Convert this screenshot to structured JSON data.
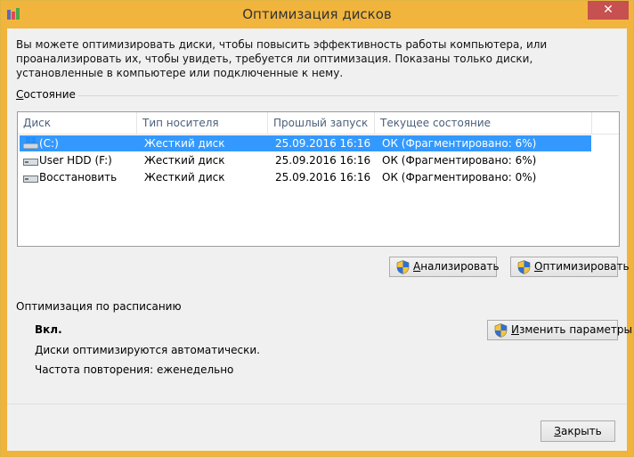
{
  "window": {
    "title": "Оптимизация дисков",
    "close_glyph": "✕"
  },
  "description": "Вы можете оптимизировать диски, чтобы повысить эффективность работы  компьютера, или проанализировать их, чтобы увидеть, требуется ли оптимизация. Показаны только диски, установленные в компьютере или подключенные к нему.",
  "status_group": {
    "label_first": "С",
    "label_rest": "остояние"
  },
  "table": {
    "columns": [
      "Диск",
      "Тип носителя",
      "Прошлый запуск",
      "Текущее состояние"
    ],
    "rows": [
      {
        "disk": "(C:)",
        "type": "Жесткий диск",
        "last_run": "25.09.2016 16:16",
        "status": "ОК (Фрагментировано: 6%)",
        "icon": "windows-drive-icon",
        "selected": true
      },
      {
        "disk": "User HDD (F:)",
        "type": "Жесткий диск",
        "last_run": "25.09.2016 16:16",
        "status": "ОК (Фрагментировано: 6%)",
        "icon": "hdd-icon",
        "selected": false
      },
      {
        "disk": "Восстановить",
        "type": "Жесткий диск",
        "last_run": "25.09.2016 16:16",
        "status": "ОК (Фрагментировано: 0%)",
        "icon": "hdd-icon",
        "selected": false
      }
    ]
  },
  "buttons": {
    "analyze": {
      "mnemonic": "А",
      "rest": "нализировать"
    },
    "optimize": {
      "mnemonic": "О",
      "rest": "птимизировать"
    },
    "change_settings": {
      "mnemonic": "И",
      "rest": "зменить параметры"
    },
    "close": {
      "mnemonic": "З",
      "rest": "акрыть"
    }
  },
  "schedule": {
    "title": "Оптимизация по расписанию",
    "state": "Вкл.",
    "auto_text": "Диски оптимизируются автоматически.",
    "frequency_label": "Частота повторения: еженедельно"
  },
  "colors": {
    "titlebar": "#f1b53e",
    "selection": "#3399ff",
    "close_button": "#c75050"
  }
}
